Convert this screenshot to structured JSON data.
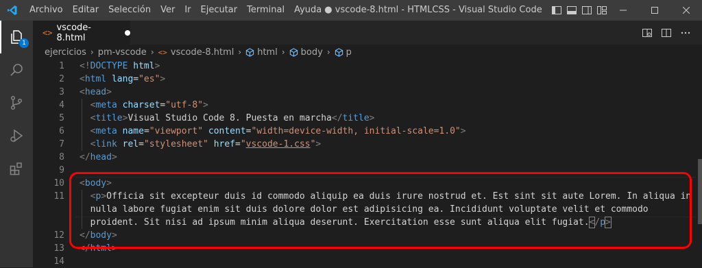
{
  "window": {
    "title": "● vscode-8.html - HTMLCSS - Visual Studio Code",
    "menu": [
      "Archivo",
      "Editar",
      "Selección",
      "Ver",
      "Ir",
      "Ejecutar",
      "Terminal",
      "Ayuda"
    ]
  },
  "activity": {
    "explorer_badge": "1",
    "items": [
      "explorer-icon",
      "search-icon",
      "source-control-icon",
      "run-debug-icon",
      "extensions-icon"
    ]
  },
  "tab": {
    "icon": "<>",
    "label": "vscode-8.html"
  },
  "breadcrumb": {
    "items": [
      "ejercicios",
      "pm-vscode",
      "vscode-8.html",
      "html",
      "body",
      "p"
    ]
  },
  "editor": {
    "line_numbers": [
      "1",
      "2",
      "3",
      "4",
      "5",
      "6",
      "7",
      "8",
      "9",
      "10",
      "11",
      "",
      "",
      "12",
      "13",
      "14"
    ],
    "lines": {
      "l1_lt": "<!",
      "l1_tag": "DOCTYPE",
      "l1_attr": "html",
      "l1_gt": ">",
      "l2_tag": "html",
      "l2_attr": "lang",
      "l2_val": "\"es\"",
      "l3_tag": "head",
      "l4_tag": "meta",
      "l4_attr": "charset",
      "l4_val": "\"utf-8\"",
      "l5_tag": "title",
      "l5_text": "Visual Studio Code 8. Puesta en marcha",
      "l5_close": "title",
      "l6_tag": "meta",
      "l6_attr1": "name",
      "l6_val1": "\"viewport\"",
      "l6_attr2": "content",
      "l6_val2": "\"width=device-width, initial-scale=1.0\"",
      "l7_tag": "link",
      "l7_attr1": "rel",
      "l7_val1": "\"stylesheet\"",
      "l7_attr2": "href",
      "l7_val2_q1": "\"",
      "l7_val2": "vscode-1.css",
      "l7_val2_q2": "\"",
      "l8_close": "head",
      "l10_tag": "body",
      "l11_tag": "p",
      "l11_text_a": "Officia sit excepteur duis id commodo aliquip ea duis irure nostrud et. Est sint sit aute Lorem. In aliqua in",
      "l11_text_b": "nulla labore fugiat enim sit duis dolore dolor est adipisicing ea. Incididunt voluptate velit et commodo",
      "l11_text_c": "proident. Sit nisi ad ipsum minim aliqua deserunt. Exercitation esse sunt aliqua elit fugiat.",
      "l11_close": "p",
      "l12_close": "body",
      "l13_close": "html"
    }
  },
  "colors": {
    "highlight_border": "#ff0000",
    "tag": "#569cd6",
    "attr": "#9cdcfe",
    "string": "#ce9178"
  }
}
